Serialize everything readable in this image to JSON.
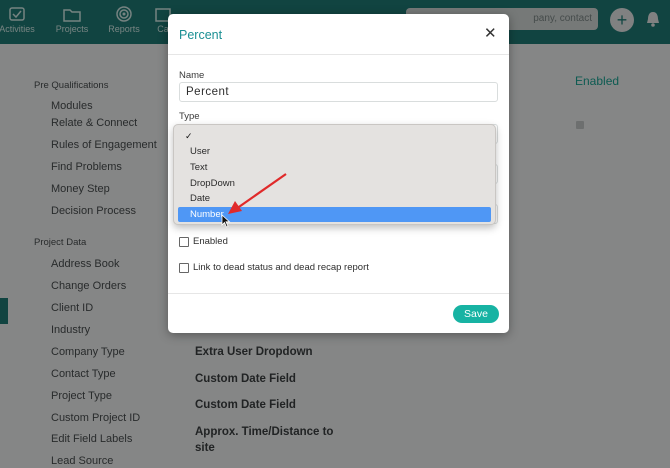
{
  "nav": {
    "items": [
      {
        "label": "Activities",
        "icon": "activities-icon"
      },
      {
        "label": "Projects",
        "icon": "folder-icon"
      },
      {
        "label": "Reports",
        "icon": "target-icon"
      },
      {
        "label": "Ca",
        "icon": "calendar-icon"
      }
    ],
    "search_text": "pany, contact",
    "add_label": "+"
  },
  "sidebar": {
    "pre_qual_title": "Pre Qualifications",
    "pre_qual_items": [
      "Modules",
      "Relate & Connect",
      "Rules of Engagement",
      "Find Problems",
      "Money Step",
      "Decision Process"
    ],
    "project_data_title": "Project Data",
    "project_data_items": [
      "Address Book",
      "Change Orders",
      "Client ID",
      "Industry",
      "Company Type",
      "Contact Type",
      "Project Type",
      "Custom Project ID",
      "Edit Field Labels",
      "Lead Source"
    ]
  },
  "main": {
    "enabled_header": "Enabled",
    "rows": [
      "Extra User Dropdown",
      "Custom Date Field",
      "Custom Date Field",
      "Approx. Time/Distance to",
      "site"
    ]
  },
  "modal": {
    "title": "Percent",
    "close_glyph": "✕",
    "name_label": "Name",
    "name_value": "Percent",
    "type_label": "Type",
    "enabled_label": "Enabled",
    "dead_status_label": "Link to dead status and dead recap report",
    "save_label": "Save"
  },
  "type_dropdown": {
    "checkmark": "✓",
    "options": [
      "",
      "User",
      "Text",
      "DropDown",
      "Date",
      "Number"
    ],
    "highlighted": "Number"
  },
  "colors": {
    "topbar": "#1f7d77",
    "accent": "#1aa796",
    "save_button": "#17b3a3",
    "highlight": "#4f97f5",
    "arrow": "#e02a2a"
  }
}
